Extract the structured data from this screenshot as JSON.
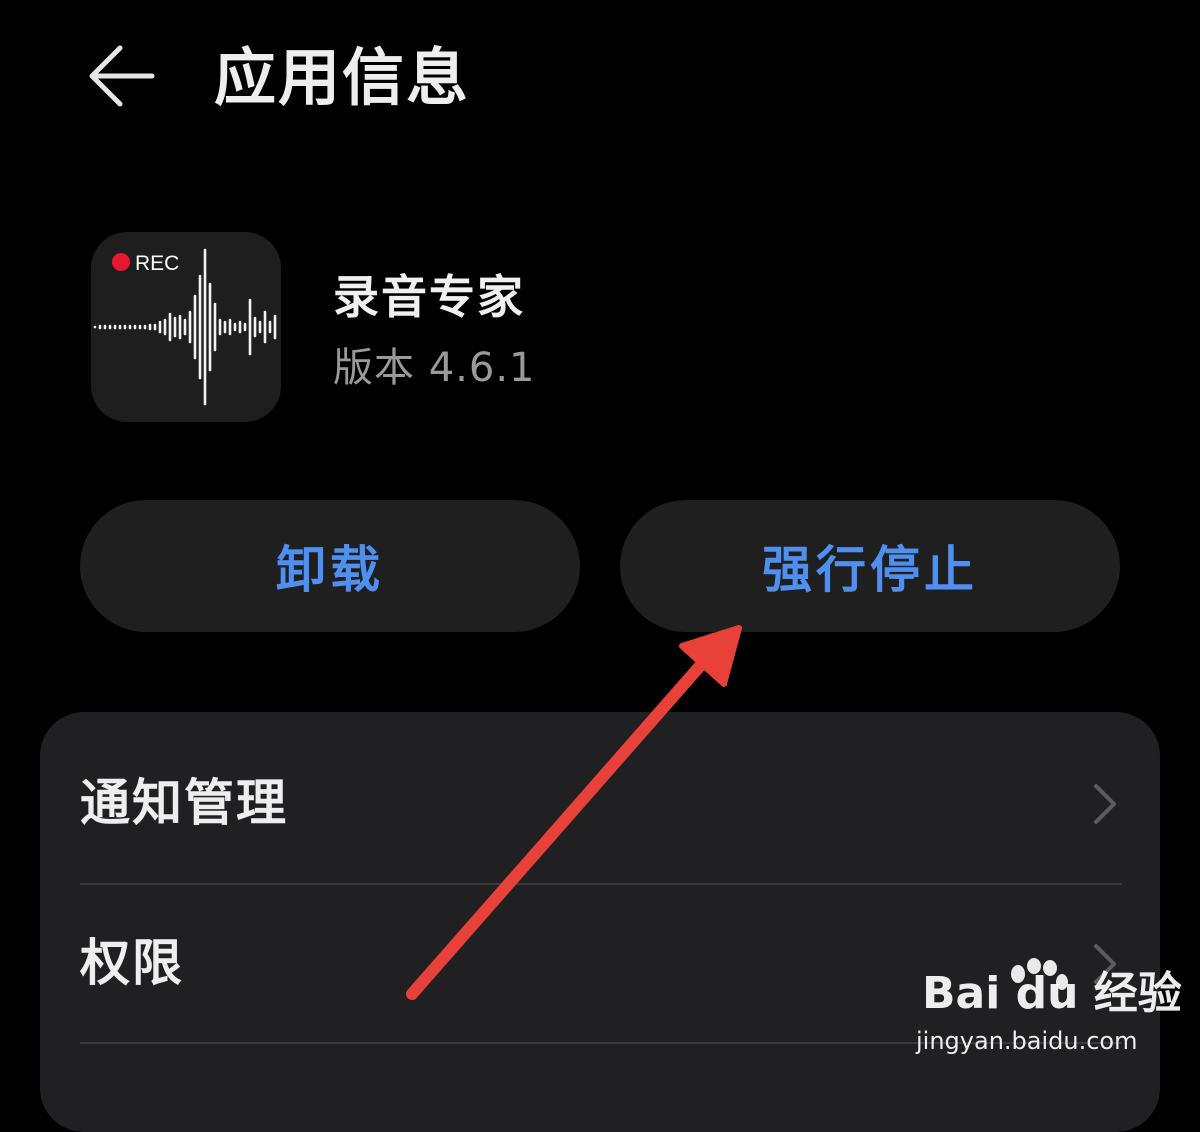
{
  "header": {
    "title": "应用信息",
    "back_icon": "arrow-left-icon"
  },
  "app": {
    "name": "录音专家",
    "version": "版本 4.6.1",
    "icon_badge": "REC",
    "icon_badge_color": "#e8162e"
  },
  "actions": {
    "uninstall_label": "卸载",
    "force_stop_label": "强行停止",
    "accent_color": "#4f8ff0"
  },
  "settings": {
    "items": [
      {
        "label": "通知管理",
        "icon": "chevron-right-icon"
      },
      {
        "label": "权限",
        "icon": "chevron-right-icon"
      }
    ]
  },
  "annotation": {
    "arrow_color": "#e8413a"
  },
  "watermark": {
    "logo": "Bai du 经验",
    "url": "jingyan.baidu.com"
  }
}
